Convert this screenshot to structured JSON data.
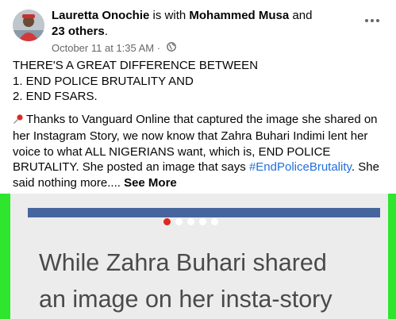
{
  "post": {
    "author": "Lauretta Onochie",
    "with_text": " is with ",
    "tagged_person": "Mohammed Musa",
    "and_text": " and ",
    "others_text": "23 others",
    "period": ".",
    "timestamp": "October 11 at 1:35 AM",
    "dot_separator": " · ",
    "privacy_icon": "globe-icon",
    "more_icon": "more-options-icon"
  },
  "body": {
    "line1": "THERE'S A GREAT DIFFERENCE BETWEEN",
    "line2": "1. END POLICE BRUTALITY AND",
    "line3": "2. END FSARS.",
    "para2_icon": "pushpin-icon",
    "para2_text": "Thanks to Vanguard Online that captured the image she shared on her Instagram Story, we now know that Zahra Buhari Indimi lent her voice to what ALL NIGERIANS want, which is, END POLICE BRUTALITY. She posted an image that says ",
    "hashtag": "#EndPoliceBrutality",
    "para2_tail": ". She said nothing more.... ",
    "see_more": "See More"
  },
  "media": {
    "caption_line1": "While Zahra Buhari shared",
    "caption_line2": "an image on her insta-story",
    "carousel_dots": 5,
    "active_dot": 0,
    "colors": {
      "frame": "#2ee62e",
      "bar": "#47659d",
      "active_dot": "#e0281f"
    }
  }
}
